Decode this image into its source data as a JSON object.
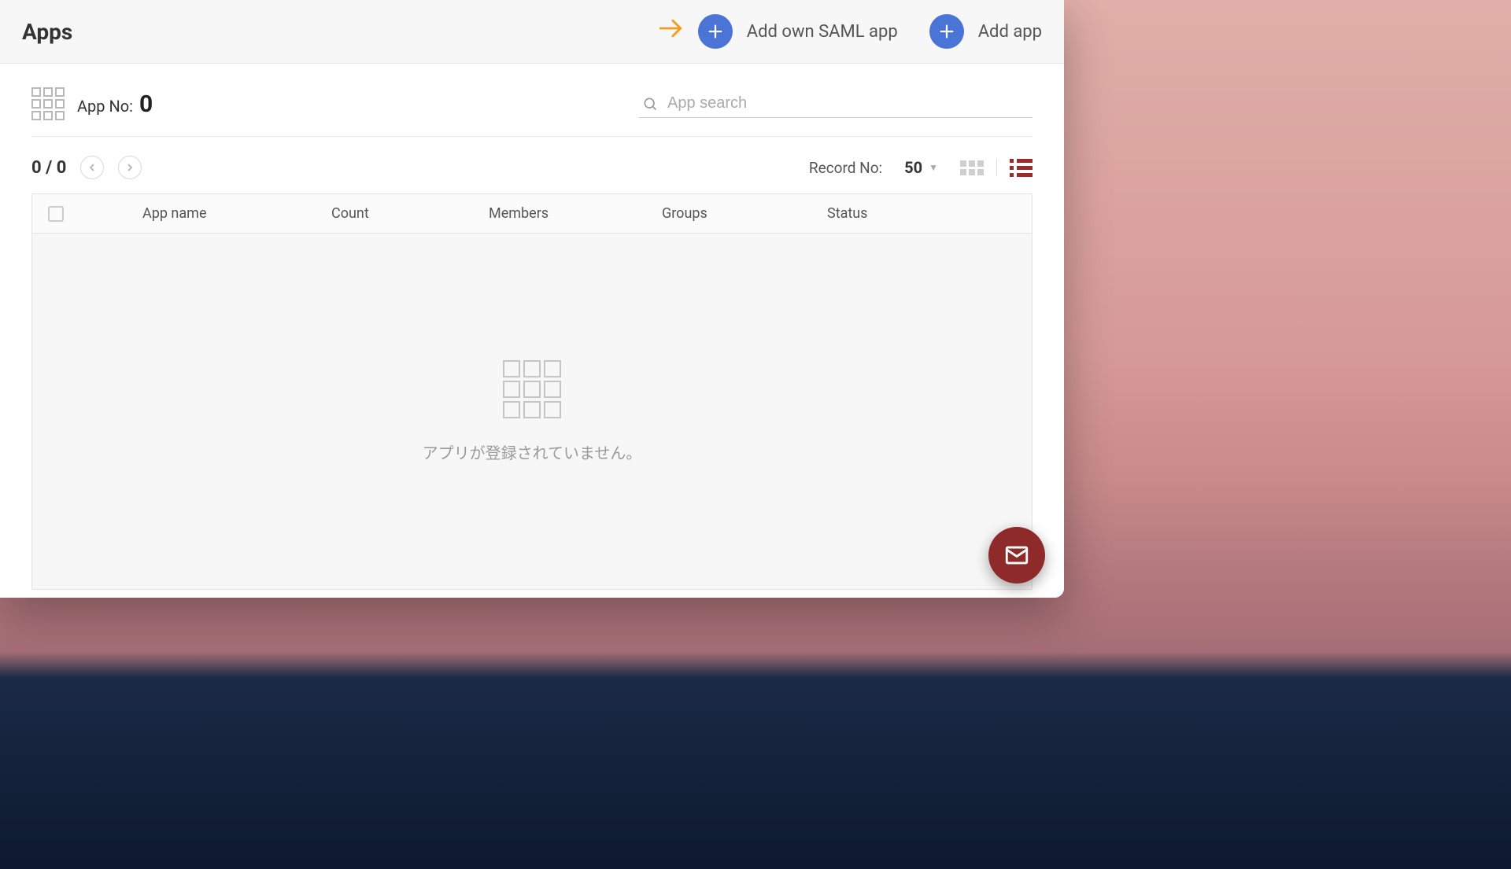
{
  "header": {
    "title": "Apps",
    "add_saml_label": "Add own SAML app",
    "add_app_label": "Add app"
  },
  "subheader": {
    "appno_label": "App No:",
    "appno_value": "0",
    "search_placeholder": "App search"
  },
  "toolbar": {
    "pager_text": "0 / 0",
    "recordno_label": "Record No:",
    "recordno_value": "50"
  },
  "table": {
    "columns": {
      "app_name": "App name",
      "count": "Count",
      "members": "Members",
      "groups": "Groups",
      "status": "Status"
    },
    "empty_message": "アプリが登録されていません。"
  }
}
